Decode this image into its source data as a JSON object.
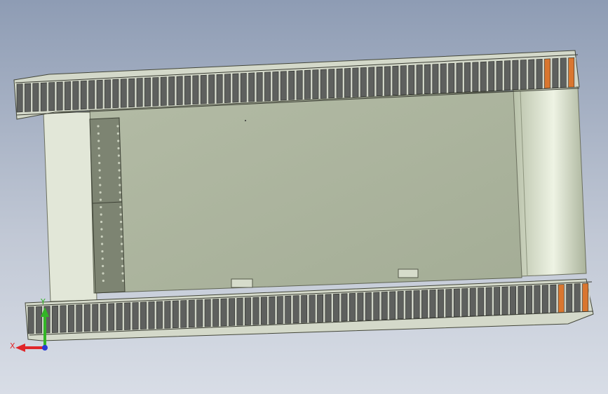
{
  "viewport": {
    "background_top": "#8e9cb4",
    "background_bottom": "#d8dde6"
  },
  "model": {
    "body_color": "#a9b29b",
    "end_face_color": "#e2e7d8",
    "roller_color": "#d9e1cc",
    "track_link_color": "#5e605e",
    "track_pin_color": "#d0d4c8",
    "plate_color": "#7d8472",
    "accent_color": "#d9762f"
  },
  "triad": {
    "x_label": "X",
    "y_label": "Y",
    "x_color": "#e0262a",
    "y_color": "#33b526",
    "z_color": "#2a3cd6"
  }
}
